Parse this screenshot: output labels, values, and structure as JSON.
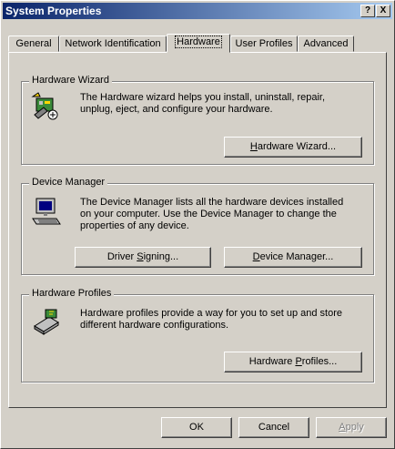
{
  "window": {
    "title": "System Properties",
    "help_label": "?",
    "close_label": "X"
  },
  "tabs": [
    {
      "label": "General"
    },
    {
      "label": "Network Identification"
    },
    {
      "label": "Hardware"
    },
    {
      "label": "User Profiles"
    },
    {
      "label": "Advanced"
    }
  ],
  "wizard": {
    "title": "Hardware Wizard",
    "desc": "The Hardware wizard helps you install, uninstall, repair, unplug, eject, and configure your hardware.",
    "button_pre": "",
    "button_key": "H",
    "button_post": "ardware Wizard...",
    "icon": "hardware-wizard-icon"
  },
  "devmgr": {
    "title": "Device Manager",
    "desc": "The Device Manager lists all the hardware devices installed on your computer. Use the Device Manager to change the properties of any device.",
    "signing_pre": "Driver ",
    "signing_key": "S",
    "signing_post": "igning...",
    "dm_pre": "",
    "dm_key": "D",
    "dm_post": "evice Manager...",
    "icon": "computer-icon"
  },
  "profiles": {
    "title": "Hardware Profiles",
    "desc": "Hardware profiles provide a way for you to set up and store different hardware configurations.",
    "button_pre": "Hardware ",
    "button_key": "P",
    "button_post": "rofiles...",
    "icon": "hardware-profiles-icon"
  },
  "footer": {
    "ok": "OK",
    "cancel": "Cancel",
    "apply_key": "A",
    "apply_post": "pply"
  }
}
